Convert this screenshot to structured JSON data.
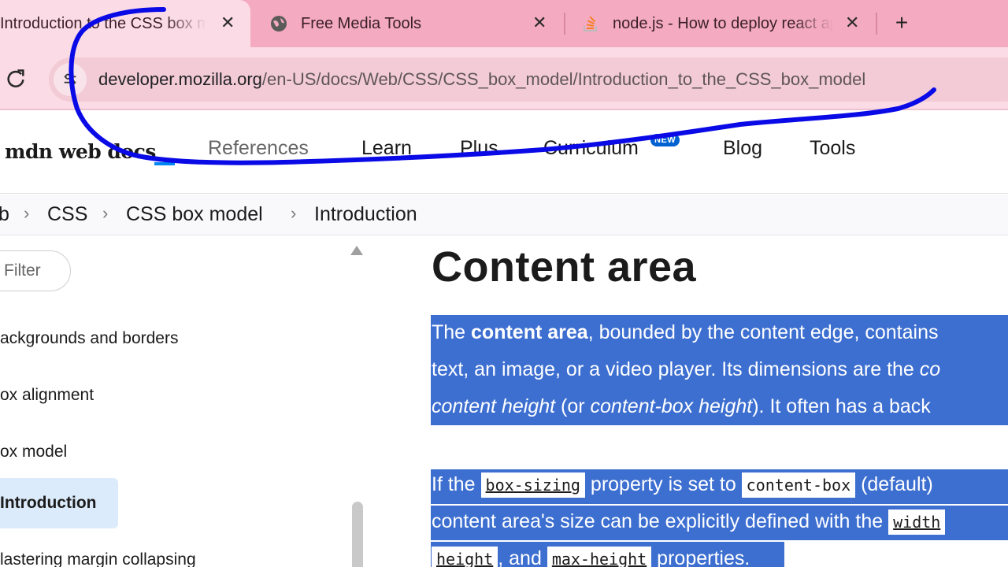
{
  "browser": {
    "tabs": [
      {
        "title": "Introduction to the CSS box model",
        "close": "✕",
        "active": true
      },
      {
        "title": "Free Media Tools",
        "close": "✕",
        "icon": "globe-icon"
      },
      {
        "title": "node.js - How to deploy react app",
        "close": "✕",
        "icon": "stackoverflow-icon"
      }
    ],
    "new_tab": "+",
    "url_host": "developer.mozilla.org",
    "url_path": "/en-US/docs/Web/CSS/CSS_box_model/Introduction_to_the_CSS_box_model"
  },
  "mdn": {
    "logo": "mdn web docs",
    "nav": [
      "References",
      "Learn",
      "Plus",
      "Curriculum",
      "Blog",
      "Tools"
    ],
    "new_badge": "NEW",
    "breadcrumbs": [
      "b",
      "CSS",
      "CSS box model",
      "Introduction"
    ],
    "crumb_sep": "›"
  },
  "sidebar": {
    "filter_placeholder": "Filter",
    "items": [
      "ackgrounds and borders",
      "ox alignment",
      "ox model",
      "Introduction",
      "lastering margin collapsing"
    ]
  },
  "content": {
    "heading": "Content area",
    "p1_line1_pre": "The ",
    "p1_line1_bold": "content area",
    "p1_line1_post": ", bounded by the content edge, contains",
    "p1_line2_pre": "text, an image, or a video player. Its dimensions are the ",
    "p1_line2_ital": "co",
    "p1_line3_ital1": "content height",
    "p1_line3_mid": " (or ",
    "p1_line3_ital2": "content-box height",
    "p1_line3_post": "). It often has a back",
    "p2_line1_pre": "If the ",
    "p2_code1": "box-sizing",
    "p2_line1_mid": " property is set to ",
    "p2_code2": "content-box",
    "p2_line1_post": " (default)",
    "p2_line2_pre": "content area's size can be explicitly defined with the ",
    "p2_code3": "width",
    "p2_code4": "height",
    "p2_line3_mid": ", and ",
    "p2_code5": "max-height",
    "p2_line3_post": " properties."
  },
  "colors": {
    "tab_strip": "#f4aac0",
    "toolbar": "#fbdbe5",
    "selection": "#3d6fd1",
    "annotation": "#0a0ae6",
    "mdn_accent": "#0085f2"
  }
}
